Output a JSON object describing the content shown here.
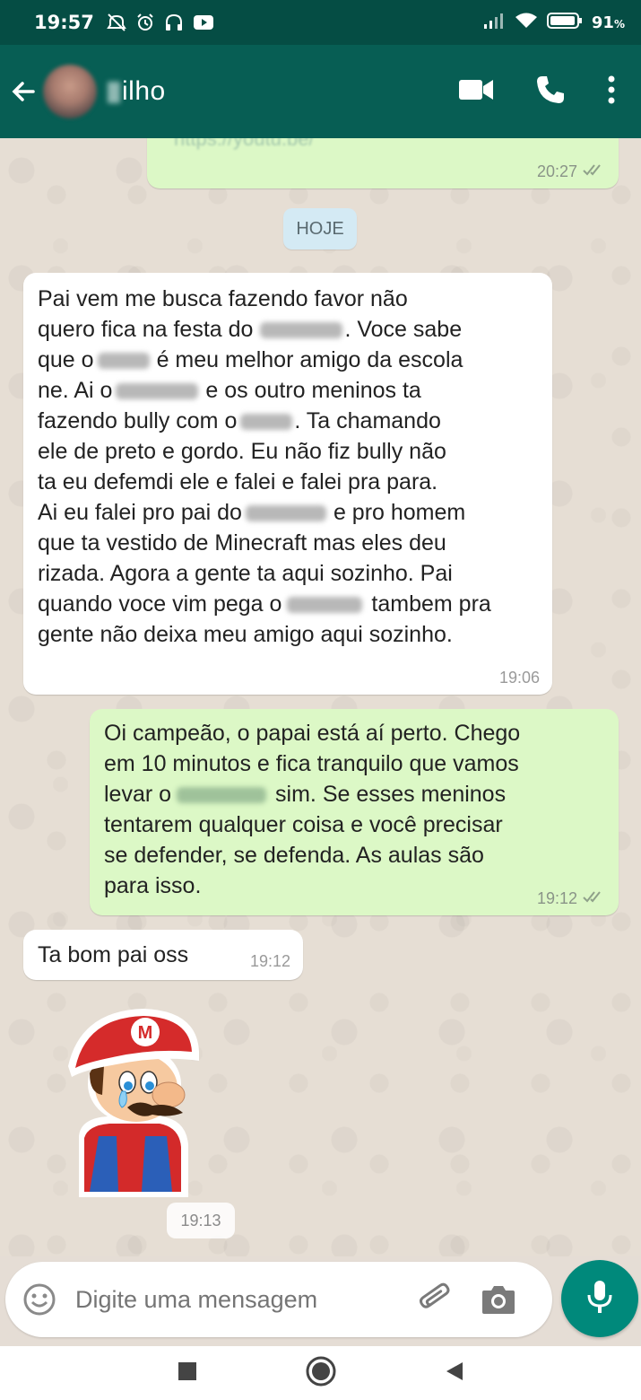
{
  "status_bar": {
    "time": "19:57",
    "battery": "91",
    "battery_unit": "%"
  },
  "header": {
    "contact_name": "ilho",
    "icons": [
      "back-arrow-icon",
      "video-call-icon",
      "phone-icon",
      "more-vert-icon"
    ]
  },
  "messages": {
    "previous": {
      "text": "https://youtu.be/",
      "time": "20:27",
      "status": "read"
    },
    "date_divider": "HOJE",
    "m1": {
      "direction": "incoming",
      "l1": "Pai vem me busca fazendo favor não",
      "l2": "quero fica na festa do",
      "l2b": ". Voce sabe",
      "l3a": "que o",
      "l3b": "é meu melhor amigo da escola",
      "l4a": "ne. Ai o",
      "l4b": "e os outro meninos ta",
      "l5a": "fazendo bully com o",
      "l5b": ". Ta chamando",
      "l6": "ele de preto e gordo. Eu não fiz bully não",
      "l7": "ta eu defemdi ele e falei e falei pra para.",
      "l8a": "Ai eu falei pro pai do",
      "l8b": "e pro homem",
      "l9": "que ta vestido de Minecraft mas eles deu",
      "l10": "rizada. Agora a gente ta aqui sozinho. Pai",
      "l11a": "quando voce vim pega o",
      "l11b": "tambem pra",
      "l12": "gente não deixa meu amigo aqui sozinho.",
      "time": "19:06"
    },
    "m2": {
      "direction": "outgoing",
      "l1": "Oi campeão, o papai está aí perto. Chego",
      "l2": "em 10 minutos e fica tranquilo que vamos",
      "l3a": "levar o",
      "l3b": "sim. Se esses meninos",
      "l4": "tentarem qualquer coisa e você precisar",
      "l5": "se defender, se defenda. As aulas são",
      "l6": "para isso.",
      "time": "19:12",
      "status": "read"
    },
    "m3": {
      "direction": "incoming",
      "text": "Ta bom pai oss",
      "time": "19:12"
    },
    "sticker": {
      "description_icon": "crying-mario-sticker-icon",
      "time": "19:13"
    }
  },
  "composer": {
    "placeholder": "Digite uma mensagem"
  },
  "nav": {
    "icons": [
      "recents-square-icon",
      "home-circle-icon",
      "back-triangle-icon"
    ]
  }
}
